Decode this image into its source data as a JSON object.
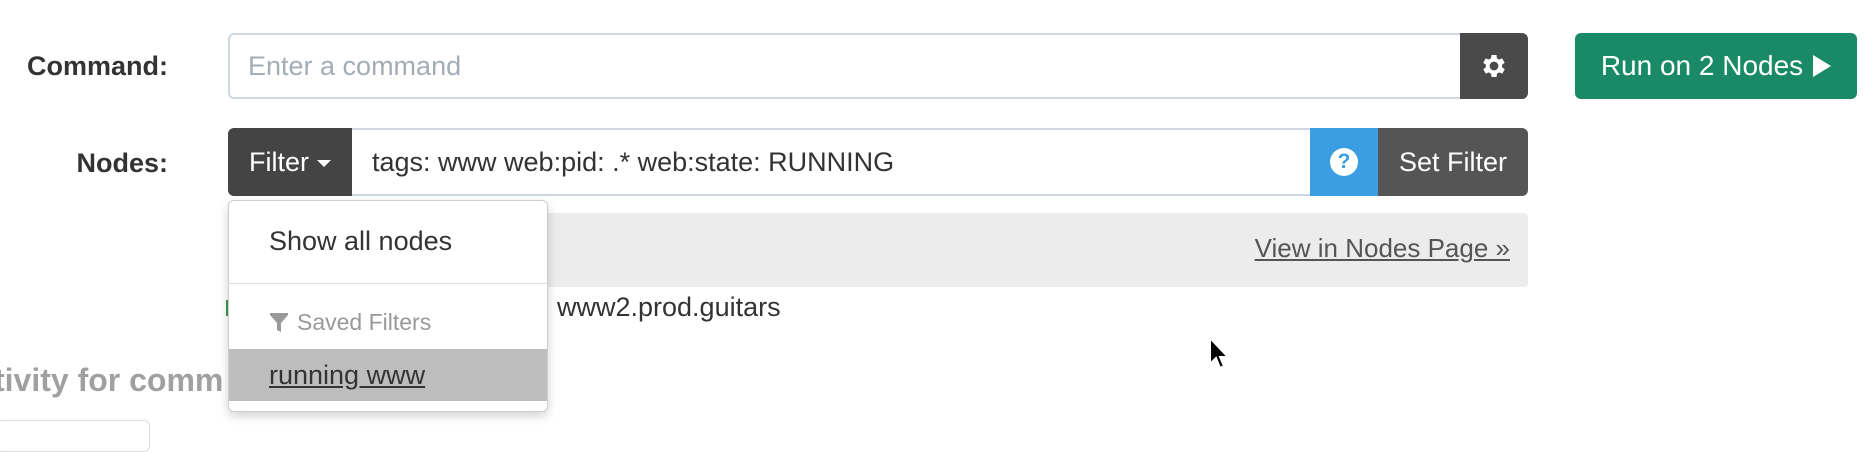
{
  "command": {
    "label": "Command:",
    "placeholder": "Enter a command",
    "value": "",
    "settings_icon": "gear-icon",
    "run_label": "Run on 2 Nodes",
    "run_icon": "play-icon",
    "run_color": "#1a8a66"
  },
  "nodes": {
    "label": "Nodes:",
    "filter_label": "Filter",
    "filter_value": "tags: www web:pid: .* web:state: RUNNING",
    "help_icon": "question-icon",
    "help_color": "#3b9ee3",
    "set_filter_label": "Set Filter",
    "view_link": "View in Nodes Page »",
    "matched_node": "www2.prod.guitars"
  },
  "dropdown": {
    "show_all": "Show all nodes",
    "saved_header": "Saved Filters",
    "saved_icon": "filter-icon",
    "saved_items": [
      "running www"
    ]
  },
  "activity": {
    "heading_partial": "tivity for comm"
  }
}
